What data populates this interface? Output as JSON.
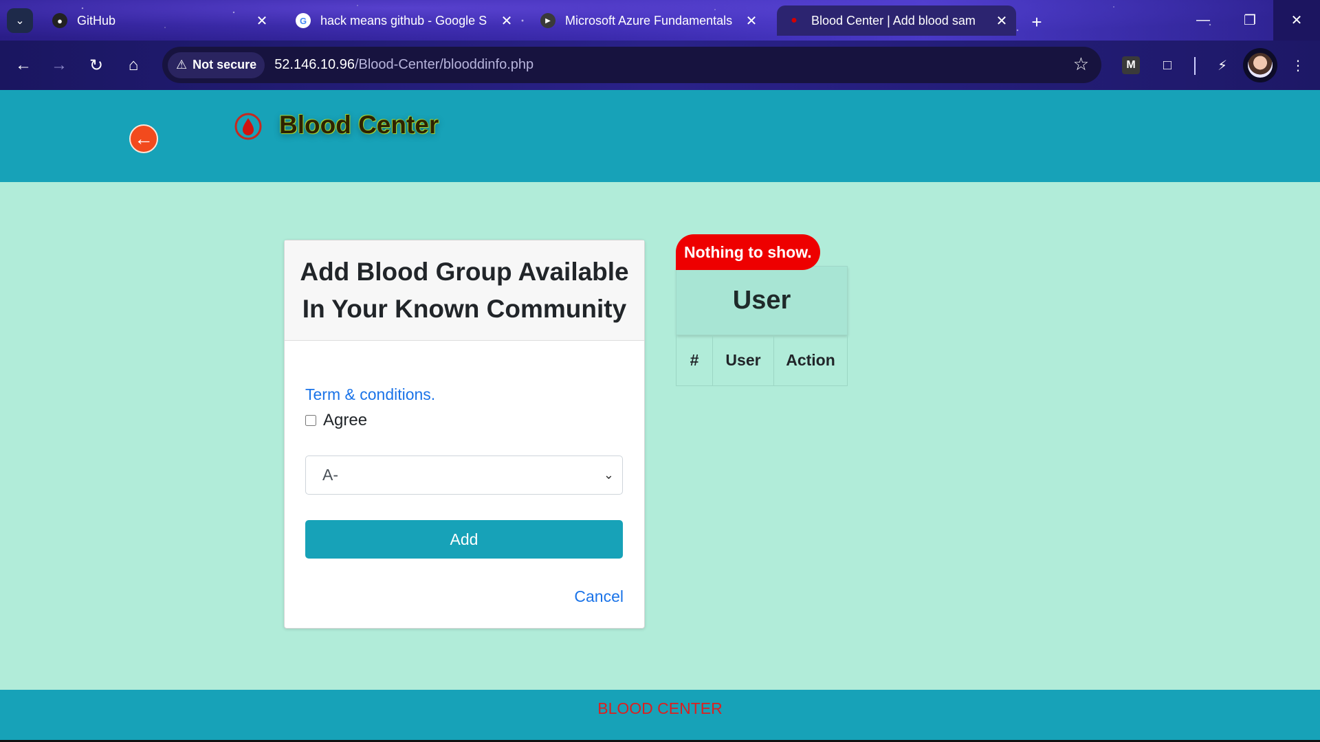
{
  "browser": {
    "tabs": [
      {
        "title": "GitHub",
        "favicon": "github-icon",
        "active": false
      },
      {
        "title": "hack means github - Google S",
        "favicon": "google-icon",
        "active": false
      },
      {
        "title": "Microsoft Azure Fundamentals",
        "favicon": "youtube-icon",
        "active": false
      },
      {
        "title": "Blood Center | Add blood sam",
        "favicon": "blood-drop-icon",
        "active": true
      }
    ],
    "security_label": "Not secure",
    "url_host": "52.146.10.96",
    "url_path": "/Blood-Center/blooddinfo.php",
    "extension_m": "M"
  },
  "header": {
    "brand": "Blood Center",
    "back_color": "#f24a1d",
    "bar_color": "#17a2b8"
  },
  "form": {
    "title": "Add Blood Group Available In Your Known Community",
    "terms_link": "Term & conditions.",
    "agree_label": "Agree",
    "agree_checked": false,
    "blood_group_selected": "A-",
    "add_button": "Add",
    "cancel_link": "Cancel"
  },
  "user_panel": {
    "empty_message": "Nothing to show.",
    "title": "User",
    "columns": [
      "#",
      "User",
      "Action"
    ]
  },
  "footer": {
    "text": "BLOOD CENTER"
  }
}
